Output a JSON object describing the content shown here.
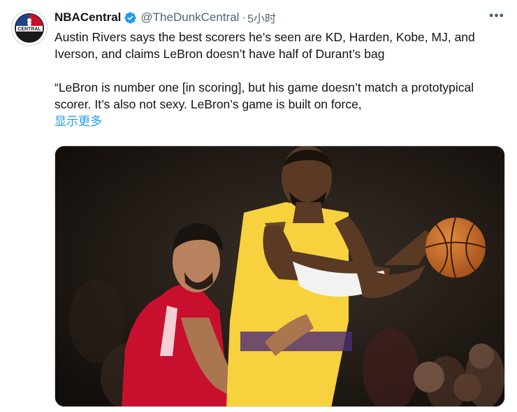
{
  "tweet": {
    "author": {
      "display_name": "NBACentral",
      "handle": "@TheDunkCentral",
      "verified": true,
      "avatar_text": "CENTRAL",
      "avatar_colors": [
        "#1d428a",
        "#c8102e"
      ]
    },
    "separator": "·",
    "timestamp": "5小时",
    "more_icon": "•••",
    "text_paragraph_1": "Austin Rivers says the best scorers he’s seen are KD, Harden, Kobe, MJ, and Iverson, and claims LeBron doesn’t have half of Durant’s bag",
    "text_paragraph_2": "“LeBron is number one [in scoring], but his game doesn’t match a prototypical scorer. It’s also not sexy. LeBron’s game is built on force,",
    "show_more_label": "显示更多",
    "link_color": "#1d9bf0"
  },
  "media": {
    "type": "photo",
    "description_icon": "basketball-photo",
    "colors": {
      "background": "#1b1612",
      "lakers_jersey": "#f7d23e",
      "rockets_jersey": "#c8102e",
      "ball": "#c8641e",
      "sleeve": "#f2f2f2"
    }
  }
}
